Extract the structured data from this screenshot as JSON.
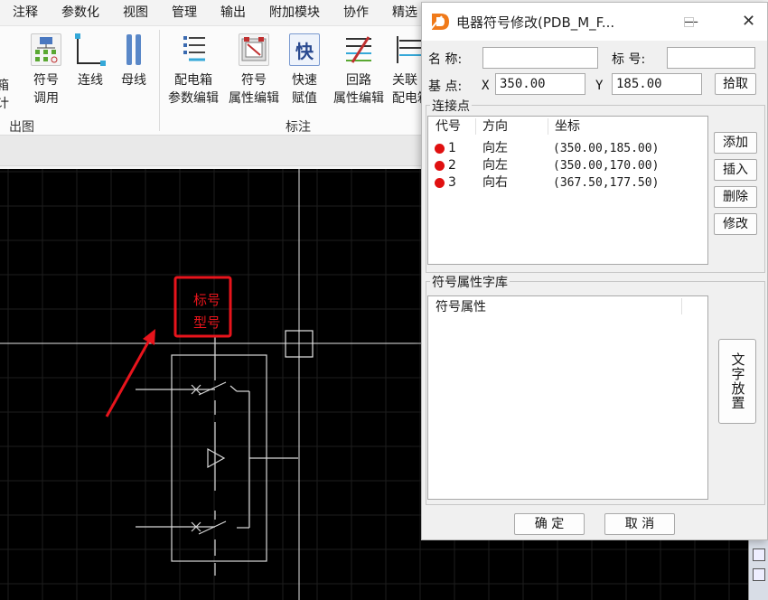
{
  "menubar": {
    "items": [
      "注释",
      "参数化",
      "视图",
      "管理",
      "输出",
      "附加模块",
      "协作",
      "精选"
    ]
  },
  "ribbon": {
    "cut_labels": [
      "箱",
      "计"
    ],
    "buttons": [
      {
        "lines": [
          "符号",
          "调用"
        ],
        "icon": "symbol-call-icon"
      },
      {
        "lines": [
          "连线"
        ],
        "icon": "connect-line-icon"
      },
      {
        "lines": [
          "母线"
        ],
        "icon": "busbar-icon"
      },
      {
        "lines": [
          "配电箱",
          "参数编辑"
        ],
        "icon": "distribution-box-icon"
      },
      {
        "lines": [
          "符号",
          "属性编辑"
        ],
        "icon": "symbol-property-icon"
      },
      {
        "lines": [
          "快速",
          "赋值"
        ],
        "icon": "quick-assign-icon"
      },
      {
        "lines": [
          "回路",
          "属性编辑"
        ],
        "icon": "circuit-property-icon"
      },
      {
        "lines": [
          "关联",
          "配电箱"
        ],
        "icon": "associate-box-icon"
      }
    ],
    "quick_assign_glyph": "快",
    "groups": [
      "出图",
      "标注"
    ]
  },
  "canvas": {
    "symbol_labels": [
      "标号",
      "型号"
    ]
  },
  "dialog": {
    "title": "电器符号修改(PDB_M_F...",
    "name_label": "名 称:",
    "name_value": "",
    "tag_label": "标 号:",
    "tag_value": "",
    "base_label": "基 点:",
    "x_label": "X",
    "x_value": "350.00",
    "y_label": "Y",
    "y_value": "185.00",
    "pick_button": "拾取",
    "connections": {
      "title": "连接点",
      "headers": [
        "代号",
        "方向",
        "坐标"
      ],
      "rows": [
        {
          "code": "1",
          "direction": "向左",
          "coord": "(350.00,185.00)"
        },
        {
          "code": "2",
          "direction": "向左",
          "coord": "(350.00,170.00)"
        },
        {
          "code": "3",
          "direction": "向右",
          "coord": "(367.50,177.50)"
        }
      ],
      "buttons": [
        "添加",
        "插入",
        "删除",
        "修改"
      ]
    },
    "library": {
      "title": "符号属性字库",
      "header": "符号属性",
      "text_place_button": "文字放置"
    },
    "ok_button": "确 定",
    "cancel_button": "取 消"
  },
  "colors": {
    "canvas_bg": "#000000",
    "annotation_red": "#e8141c",
    "logo_orange": "#f07a1a",
    "dot_red": "#e01010"
  }
}
